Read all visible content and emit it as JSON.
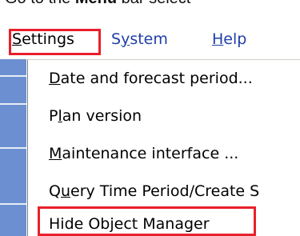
{
  "instruction": {
    "prefix": "Go to the ",
    "bold": "Menu",
    "suffix": " bar select \""
  },
  "menubar": {
    "items": [
      {
        "label_accel": "S",
        "label_rest": "ettings"
      },
      {
        "label_pre": "S",
        "label_accel": "y",
        "label_rest": "stem"
      },
      {
        "label_accel": "H",
        "label_rest": "elp"
      }
    ]
  },
  "settings_menu": {
    "items": [
      {
        "label_accel": "D",
        "label_rest": "ate and forecast period..."
      },
      {
        "label_pre": "P",
        "label_accel": "l",
        "label_rest": "an version"
      },
      {
        "label_accel": "M",
        "label_rest": "aintenance interface ..."
      },
      {
        "label_pre": "Q",
        "label_accel": "u",
        "label_rest": "ery Time Period/Create S"
      },
      {
        "label": "Hide Object Manager"
      }
    ]
  },
  "colors": {
    "highlight": "#e8202a",
    "menu_link": "#1f3ea8",
    "background_window": "#6b8fd0"
  }
}
